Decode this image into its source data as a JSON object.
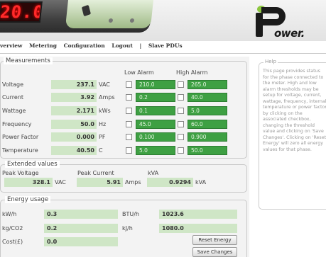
{
  "header": {
    "device_display": "20.0",
    "logo_text": "ower."
  },
  "nav": {
    "items": [
      "verview",
      "Metering",
      "Configuration",
      "Logout",
      "|",
      "Slave PDUs"
    ]
  },
  "measurements": {
    "legend": "Measurements",
    "low_alarm_header": "Low Alarm",
    "high_alarm_header": "High Alarm",
    "rows": [
      {
        "label": "Voltage",
        "value": "237.1",
        "unit": "VAC",
        "low": "210.0",
        "high": "265.0"
      },
      {
        "label": "Current",
        "value": "3.92",
        "unit": "Amps",
        "low": "0.2",
        "high": "40.0"
      },
      {
        "label": "Wattage",
        "value": "2.171",
        "unit": "kWs",
        "low": "0.1",
        "high": "5.0"
      },
      {
        "label": "Frequency",
        "value": "50.0",
        "unit": "Hz",
        "low": "45.0",
        "high": "60.0"
      },
      {
        "label": "Power Factor",
        "value": "0.000",
        "unit": "PF",
        "low": "0.100",
        "high": "0.900"
      },
      {
        "label": "Temperature",
        "value": "40.50",
        "unit": "C",
        "low": "5.0",
        "high": "50.0"
      }
    ]
  },
  "extended": {
    "legend": "Extended values",
    "peak_voltage_label": "Peak Voltage",
    "peak_voltage_value": "328.1",
    "peak_voltage_unit": "VAC",
    "peak_current_label": "Peak Current",
    "peak_current_value": "5.91",
    "peak_current_unit": "Amps",
    "kva_label": "kVA",
    "kva_value": "0.9294",
    "kva_unit": "kVA"
  },
  "energy": {
    "legend": "Energy usage",
    "kwh_label": "kW/h",
    "kwh_value": "0.3",
    "btu_label": "BTU/h",
    "btu_value": "1023.6",
    "co2_label": "kg/CO2",
    "co2_value": "0.2",
    "kj_label": "kJ/h",
    "kj_value": "1080.0",
    "cost_label": "Cost(£)",
    "cost_value": "0.0",
    "reset_button": "Reset Energy",
    "save_button": "Save Changes"
  },
  "help": {
    "legend": "Help",
    "text": "This page provides status for the phase connected to the meter. High and low alarm thresholds may be setup for voltage, current, wattage, frequency, internal temperature or power factor by clicking on the associated checkbox, changing the threshold value and clicking on 'Save Changes'. Clicking on 'Reset Energy' will zero all energy values for that phase."
  },
  "colors": {
    "value_bg": "#cfe6c6",
    "alarm_bg": "#3ea043",
    "logo_accent": "#8cc63f",
    "display_red": "#ff2a2a"
  }
}
